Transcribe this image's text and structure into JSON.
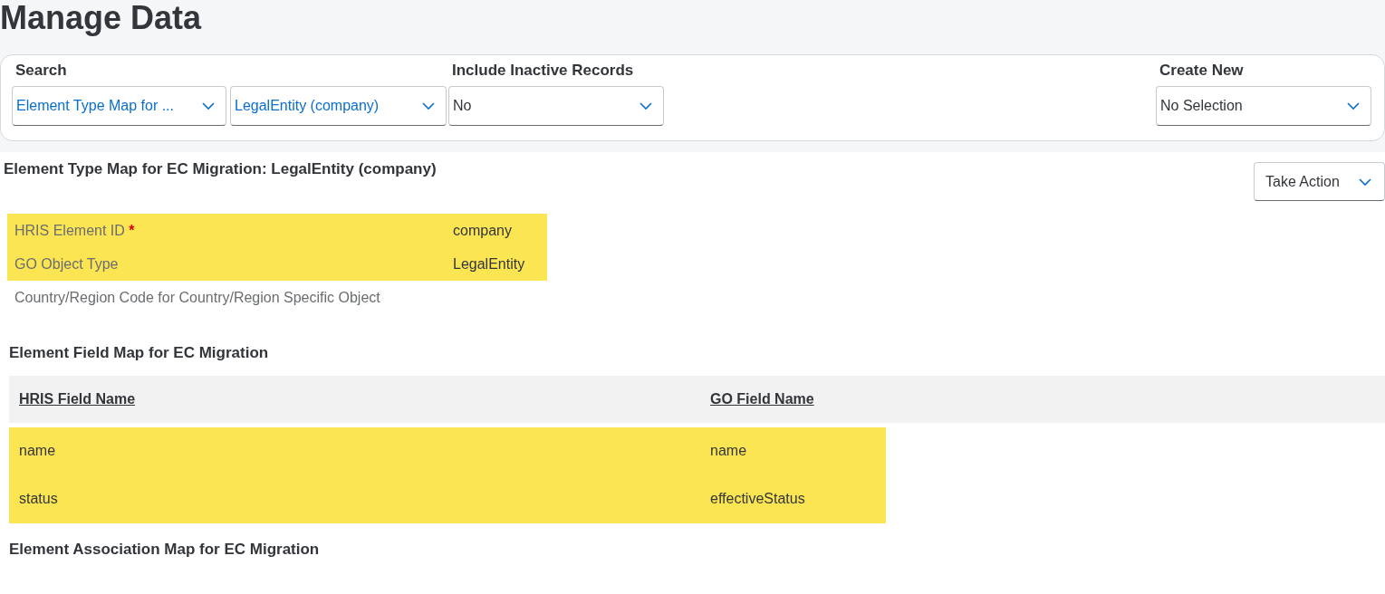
{
  "page_title": "Manage Data",
  "filters": [
    {
      "label": "Search",
      "selects": [
        {
          "value": "Element Type Map for ...",
          "linked": true
        },
        {
          "value": "LegalEntity (company)",
          "linked": true
        }
      ]
    },
    {
      "label": "Include Inactive Records",
      "selects": [
        {
          "value": "No",
          "linked": false
        }
      ]
    },
    {
      "label": "Create New",
      "selects": [
        {
          "value": "No Selection",
          "linked": false
        }
      ]
    }
  ],
  "record": {
    "title": "Element Type Map for EC Migration: LegalEntity (company)",
    "action_button": "Take Action",
    "fields": [
      {
        "label": "HRIS Element ID",
        "required_mark": "*",
        "value": "company",
        "highlighted": true
      },
      {
        "label": "GO Object Type",
        "value": "LegalEntity",
        "highlighted": true
      },
      {
        "label": "Country/Region Code for Country/Region Specific Object",
        "highlighted": false
      }
    ],
    "field_map": {
      "title": "Element Field Map for EC Migration",
      "columns": [
        "HRIS Field Name",
        "GO Field Name"
      ],
      "rows": [
        {
          "cells": [
            "name",
            "name"
          ],
          "highlighted": true
        },
        {
          "cells": [
            "status",
            "effectiveStatus"
          ],
          "highlighted": true
        }
      ]
    },
    "association_map": {
      "title": "Element Association Map for EC Migration"
    }
  }
}
